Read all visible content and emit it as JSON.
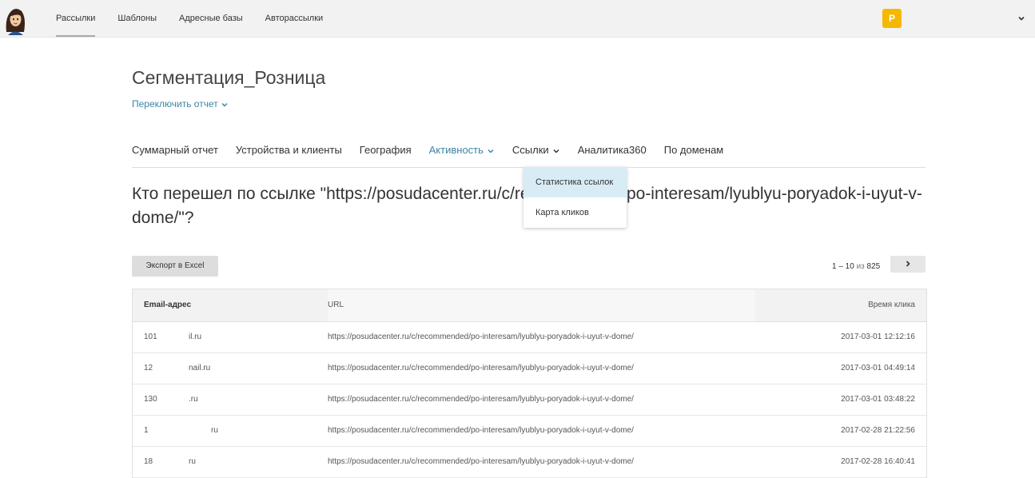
{
  "header": {
    "nav": [
      "Рассылки",
      "Шаблоны",
      "Адресные базы",
      "Авторассылки"
    ],
    "user_initial": "P"
  },
  "report": {
    "title": "Сегментация_Розница",
    "switch_label": "Переключить отчет"
  },
  "tabs": [
    "Суммарный отчет",
    "Устройства и клиенты",
    "География",
    "Активность",
    "Ссылки",
    "Аналитика360",
    "По доменам"
  ],
  "dropdown": {
    "items": [
      "Статистика ссылок",
      "Карта кликов"
    ]
  },
  "question": "Кто перешел по ссылке \"https://posudacenter.ru/c/recommended/po-interesam/lyublyu-poryadok-i-uyut-v-dome/\"?",
  "toolbar": {
    "export_label": "Экспорт в Excel",
    "pager_range": "1 – 10",
    "pager_of": "из",
    "pager_total": "825"
  },
  "table": {
    "headers": [
      "Email-адрес",
      "URL",
      "Время клика"
    ],
    "rows": [
      {
        "email_a": "101",
        "email_b": "il.ru",
        "url": "https://posudacenter.ru/c/recommended/po-interesam/lyublyu-poryadok-i-uyut-v-dome/",
        "time": "2017-03-01 12:12:16"
      },
      {
        "email_a": "12",
        "email_b": "nail.ru",
        "url": "https://posudacenter.ru/c/recommended/po-interesam/lyublyu-poryadok-i-uyut-v-dome/",
        "time": "2017-03-01 04:49:14"
      },
      {
        "email_a": "130",
        "email_b": ".ru",
        "url": "https://posudacenter.ru/c/recommended/po-interesam/lyublyu-poryadok-i-uyut-v-dome/",
        "time": "2017-03-01 03:48:22"
      },
      {
        "email_a": "1",
        "email_b": "ru",
        "url": "https://posudacenter.ru/c/recommended/po-interesam/lyublyu-poryadok-i-uyut-v-dome/",
        "time": "2017-02-28 21:22:56"
      },
      {
        "email_a": "18",
        "email_b": "ru",
        "url": "https://posudacenter.ru/c/recommended/po-interesam/lyublyu-poryadok-i-uyut-v-dome/",
        "time": "2017-02-28 16:40:41"
      }
    ]
  },
  "colors": {
    "accent": "#3b86a3",
    "avatar": "#f5b800",
    "dropdown_active": "#d8ecf5"
  }
}
